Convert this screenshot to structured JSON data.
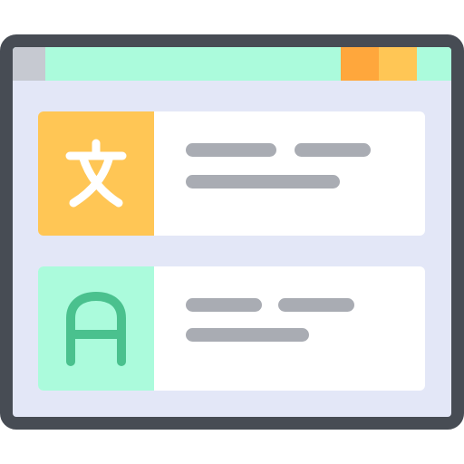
{
  "window": {
    "titlebar_colors": {
      "bar": "#abfbdc",
      "left_segment": "#c6c9d1",
      "button_1": "#ffa73c",
      "button_2": "#ffc655"
    },
    "frame_color": "#474c54",
    "content_bg": "#e3e7f7"
  },
  "cards": [
    {
      "icon": "chinese-character-icon",
      "glyph": "文",
      "badge_color": "#ffc655",
      "glyph_color": "#ffffff"
    },
    {
      "icon": "latin-letter-icon",
      "glyph": "A",
      "badge_color": "#abfbdc",
      "glyph_color": "#4ac18e"
    }
  ]
}
